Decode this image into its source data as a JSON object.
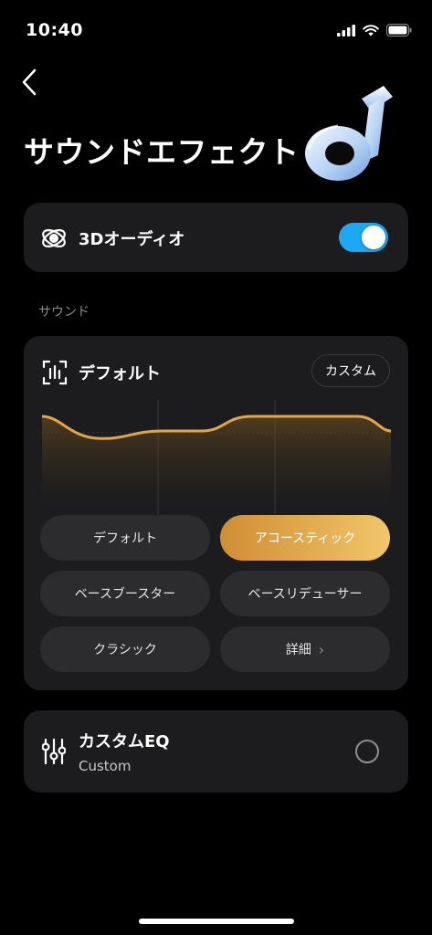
{
  "status_bar": {
    "time": "10:40"
  },
  "header": {
    "title": "サウンドエフェクト"
  },
  "audio3d": {
    "label": "3Dオーディオ",
    "enabled": true,
    "accent_color": "#1ea7f2"
  },
  "sound_section": {
    "label": "サウンド"
  },
  "sound_card": {
    "current_preset": "デフォルト",
    "custom_button": "カスタム",
    "presets": [
      {
        "label": "デフォルト",
        "active": false
      },
      {
        "label": "アコースティック",
        "active": true
      },
      {
        "label": "ベースブースター",
        "active": false
      },
      {
        "label": "ベースリデューサー",
        "active": false
      },
      {
        "label": "クラシック",
        "active": false
      },
      {
        "label": "詳細",
        "chevron": "›",
        "active": false
      }
    ],
    "accent_gradient": [
      "#cf8e34",
      "#f2c66a"
    ]
  },
  "custom_eq": {
    "title": "カスタムEQ",
    "subtitle": "Custom",
    "selected": false
  },
  "icons": {
    "back": "chevron-left-icon",
    "audio3d": "orbit-icon",
    "preset": "equalizer-icon",
    "custom_eq": "sliders-icon"
  }
}
